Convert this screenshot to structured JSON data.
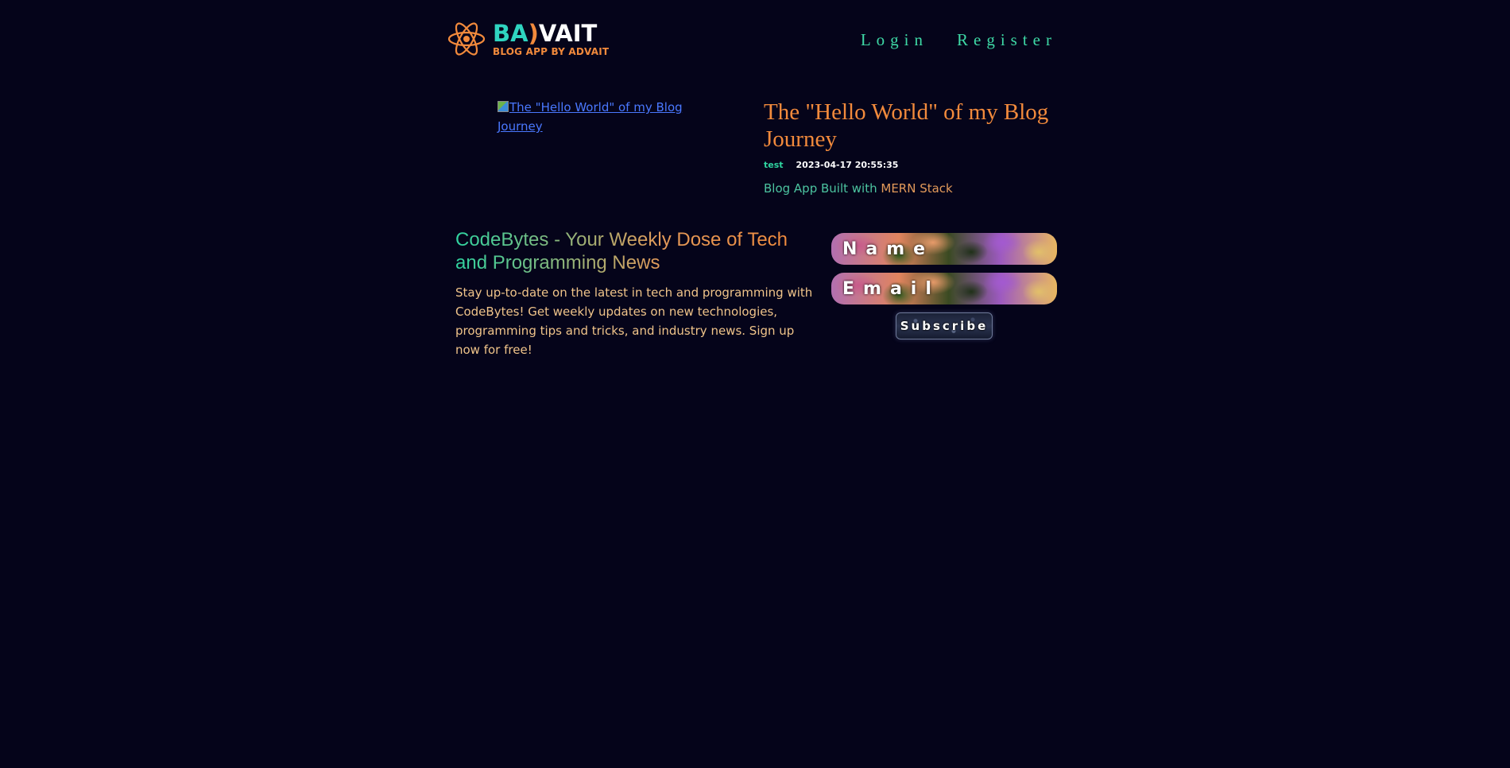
{
  "header": {
    "logo": {
      "text_part1": "BA",
      "text_part2": ")",
      "text_part3": "VAIT",
      "subtitle": "BLOG APP BY ADVAIT",
      "icon": "atom-icon"
    },
    "nav": {
      "login_label": "Login",
      "register_label": "Register"
    }
  },
  "post": {
    "image_alt": "The \"Hello World\" of my Blog Journey",
    "title": "The \"Hello World\" of my Blog Journey",
    "author": "test",
    "date": "2023-04-17 20:55:35",
    "summary_part1": "Blog App Built with ",
    "summary_part2": "MERN Stack"
  },
  "newsletter": {
    "title": "CodeBytes - Your Weekly Dose of Tech and Programming News",
    "text": "Stay up-to-date on the latest in tech and programming with CodeBytes! Get weekly updates on new technologies, programming tips and tricks, and industry news. Sign up now for free!",
    "name_placeholder": "Name",
    "email_placeholder": "Email",
    "subscribe_label": "Subscribe"
  },
  "colors": {
    "background": "#05041a",
    "accent_teal": "#2fd4a0",
    "accent_orange": "#f28a3c",
    "link_blue": "#4a78ff"
  }
}
